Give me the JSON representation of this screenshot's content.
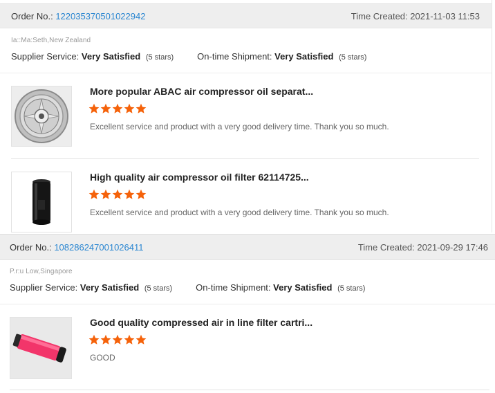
{
  "orders": [
    {
      "order_no_label": "Order No.:",
      "order_no": "122035370501022942",
      "time_label": "Time Created:",
      "time": "2021-11-03 11:53",
      "buyer": "Ia::Ma:Seth,New Zealand",
      "supplier_service_label": "Supplier Service:",
      "supplier_service_value": "Very Satisfied",
      "supplier_service_stars": "(5 stars)",
      "shipment_label": "On-time Shipment:",
      "shipment_value": "Very Satisfied",
      "shipment_stars": "(5 stars)",
      "items": [
        {
          "title": "More popular ABAC air compressor oil separat...",
          "rating": 5,
          "review": "Excellent service and product with a very good delivery time. Thank you so much.",
          "thumb_icon": "oil-separator-icon"
        },
        {
          "title": "High quality air compressor oil filter 62114725...",
          "rating": 5,
          "review": "Excellent service and product with a very good delivery time. Thank you so much.",
          "thumb_icon": "oil-filter-icon"
        }
      ]
    },
    {
      "order_no_label": "Order No.:",
      "order_no": "108286247001026411",
      "time_label": "Time Created:",
      "time": "2021-09-29 17:46",
      "buyer": "P.r:u Low,Singapore",
      "supplier_service_label": "Supplier Service:",
      "supplier_service_value": "Very Satisfied",
      "supplier_service_stars": "(5 stars)",
      "shipment_label": "On-time Shipment:",
      "shipment_value": "Very Satisfied",
      "shipment_stars": "(5 stars)",
      "items": [
        {
          "title": "Good quality compressed air in line filter cartri...",
          "rating": 5,
          "review": "GOOD",
          "thumb_icon": "filter-cartridge-icon"
        }
      ]
    }
  ],
  "colors": {
    "star": "#f5620a",
    "link": "#2a86d1",
    "header_bg": "#eeeeee"
  }
}
